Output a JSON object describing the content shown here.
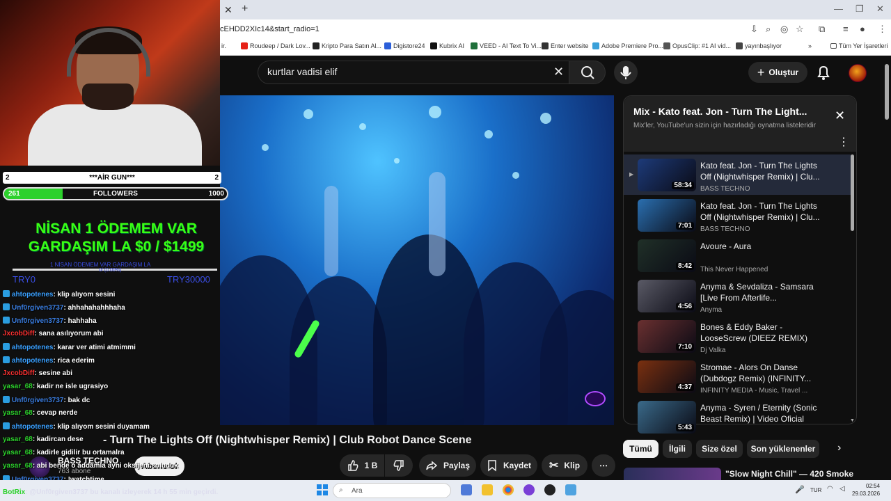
{
  "browser": {
    "url": "cEHDD2XIc14&start_radio=1",
    "bookmarks": [
      {
        "label": "Roudeep / Dark Lov...",
        "color": "#e62117"
      },
      {
        "label": "Kripto Para Satın Al...",
        "color": "#222222"
      },
      {
        "label": "Digistore24",
        "color": "#2b5fd9"
      },
      {
        "label": "Kubrix AI",
        "color": "#111111"
      },
      {
        "label": "VEED - AI Text To Vi...",
        "color": "#1f6f3a"
      },
      {
        "label": "Enter website",
        "color": "#333333"
      },
      {
        "label": "Adobe Premiere Pro...",
        "color": "#3aa0d9"
      },
      {
        "label": "OpusClip: #1 AI vid...",
        "color": "#555555"
      },
      {
        "label": "yayınbaşlıyor",
        "color": "#444444"
      }
    ],
    "all_bookmarks": "Tüm Yer İşaretleri",
    "bookmark_more": "»"
  },
  "youtube": {
    "search_query": "kurtlar vadisi elif",
    "create_label": "Oluştur",
    "video_title": "Kato feat. Jon - Turn The Lights Off (Nightwhisper Remix) | Club Robot Dance Scene",
    "video_title_visible": "- Turn The Lights Off (Nightwhisper Remix) | Club Robot Dance Scene",
    "channel": "BASS TECHNO",
    "subscribers": "763 abone",
    "subscribe_label": "Abone ol",
    "actions": {
      "like": "1 B",
      "share": "Paylaş",
      "save": "Kaydet",
      "clip": "Klip",
      "more": "⋯"
    },
    "playlist": {
      "title": "Mix - Kato feat. Jon - Turn The Light...",
      "subtitle": "Mix'ler, YouTube'un sizin için hazırladığı oynatma listeleridir",
      "items": [
        {
          "title": "Kato feat. Jon - Turn The Lights Off (Nightwhisper Remix) | Clu...",
          "channel": "BASS TECHNO",
          "duration": "58:34",
          "active": true,
          "thumb": "#1d3b7a"
        },
        {
          "title": "Kato feat. Jon - Turn The Lights Off (Nightwhisper Remix) | Clu...",
          "channel": "BASS TECHNO",
          "duration": "7:01",
          "thumb": "#2a6fb0"
        },
        {
          "title": "Avoure - Aura",
          "channel": "This Never Happened",
          "duration": "8:42",
          "thumb": "#203028"
        },
        {
          "title": "Anyma & Sevdaliza - Samsara [Live From Afterlife...",
          "channel": "Anyma",
          "duration": "4:56",
          "thumb": "#5a5a66"
        },
        {
          "title": "Bones & Eddy Baker - LooseScrew (DIEEZ REMIX)",
          "channel": "Dj Valka",
          "duration": "7:10",
          "thumb": "#6a3030"
        },
        {
          "title": "Stromae - Alors On Danse (Dubdogz Remix) (INFINITY...",
          "channel": "INFINITY MEDIA - Music, Travel ...",
          "duration": "4:37",
          "thumb": "#7a3010"
        },
        {
          "title": "Anyma - Syren / Eternity (Sonic Beast Remix) | Video Oficial",
          "channel": "",
          "duration": "5:43",
          "thumb": "#3a6a8a"
        }
      ]
    },
    "chips": [
      "Tümü",
      "İlgili",
      "Size özel",
      "Son yüklenenler"
    ],
    "recommended_title": "\"Slow Night Chill\" — 420 Smoke"
  },
  "stream": {
    "goal_title": "***AİR GUN***",
    "goal_left": "2",
    "goal_right": "2",
    "followers_label": "FOLLOWERS",
    "followers_current": "261",
    "followers_target": "1000",
    "followers_fraction": 0.261,
    "donation_title": "NİSAN 1 ÖDEMEM VAR GARDAŞIM LA $0 / $1499",
    "donation_line1": "NİSAN 1 ÖDEMEM VAR",
    "donation_line2": "GARDAŞIM LA $0 / $1499",
    "donation_small": "1 NİSAN ÖDEMEM VAR GARDAŞIM LA",
    "donation_small2": "0/ (0.00%)",
    "donation_min": "TRY0",
    "donation_max": "TRY30000",
    "chat": [
      {
        "user": "ahtopotenes",
        "msg": ": klip alıyom sesini",
        "color": "#3aa0ff",
        "tw": true
      },
      {
        "user": "Unf0rgiven3737",
        "msg": ": ahhahahahhhaha",
        "color": "#3a7de0",
        "tw": true
      },
      {
        "user": "Unf0rgiven3737",
        "msg": ": hahhaha",
        "color": "#3a7de0",
        "tw": true
      },
      {
        "user": "JxcobDiff",
        "msg": ": sana asılıyorum abi",
        "color": "#ff3030",
        "tw": false
      },
      {
        "user": "ahtopotenes",
        "msg": ": karar ver atimi atmimmi",
        "color": "#3aa0ff",
        "tw": true
      },
      {
        "user": "ahtopotenes",
        "msg": ": rica ederim",
        "color": "#3aa0ff",
        "tw": true
      },
      {
        "user": "JxcobDiff",
        "msg": ": sesine abi",
        "color": "#ff3030",
        "tw": false
      },
      {
        "user": "yasar_68",
        "msg": ": kadir ne isle ugrasiyo",
        "color": "#2cd12c",
        "tw": false
      },
      {
        "user": "Unf0rgiven3737",
        "msg": ": bak dc",
        "color": "#3a7de0",
        "tw": true
      },
      {
        "user": "yasar_68",
        "msg": ": cevap nerde",
        "color": "#2cd12c",
        "tw": false
      },
      {
        "user": "ahtopotenes",
        "msg": ": klip alıyom sesini duyamam",
        "color": "#3aa0ff",
        "tw": true
      },
      {
        "user": "yasar_68",
        "msg": ": kadircan dese",
        "color": "#2cd12c",
        "tw": false
      },
      {
        "user": "yasar_68",
        "msg": ": kadirle gidilir bu ortamalra",
        "color": "#2cd12c",
        "tw": false
      },
      {
        "user": "yasar_68",
        "msg": ": abi bende o addamla ayni oksijeni soluduk",
        "color": "#2cd12c",
        "tw": false
      },
      {
        "user": "Unf0rgiven3737",
        "msg": ": !watchtime",
        "color": "#3a7de0",
        "tw": true
      }
    ],
    "botrix_user": "BotRix",
    "botrix_msg": ": @Unf0rgiven3737 bu kanalı izleyerek 14 h 55 min geçirdi."
  },
  "taskbar": {
    "search_placeholder": "Ara",
    "lang": "TUR",
    "time": "02:54",
    "date": "29.03.2026"
  }
}
